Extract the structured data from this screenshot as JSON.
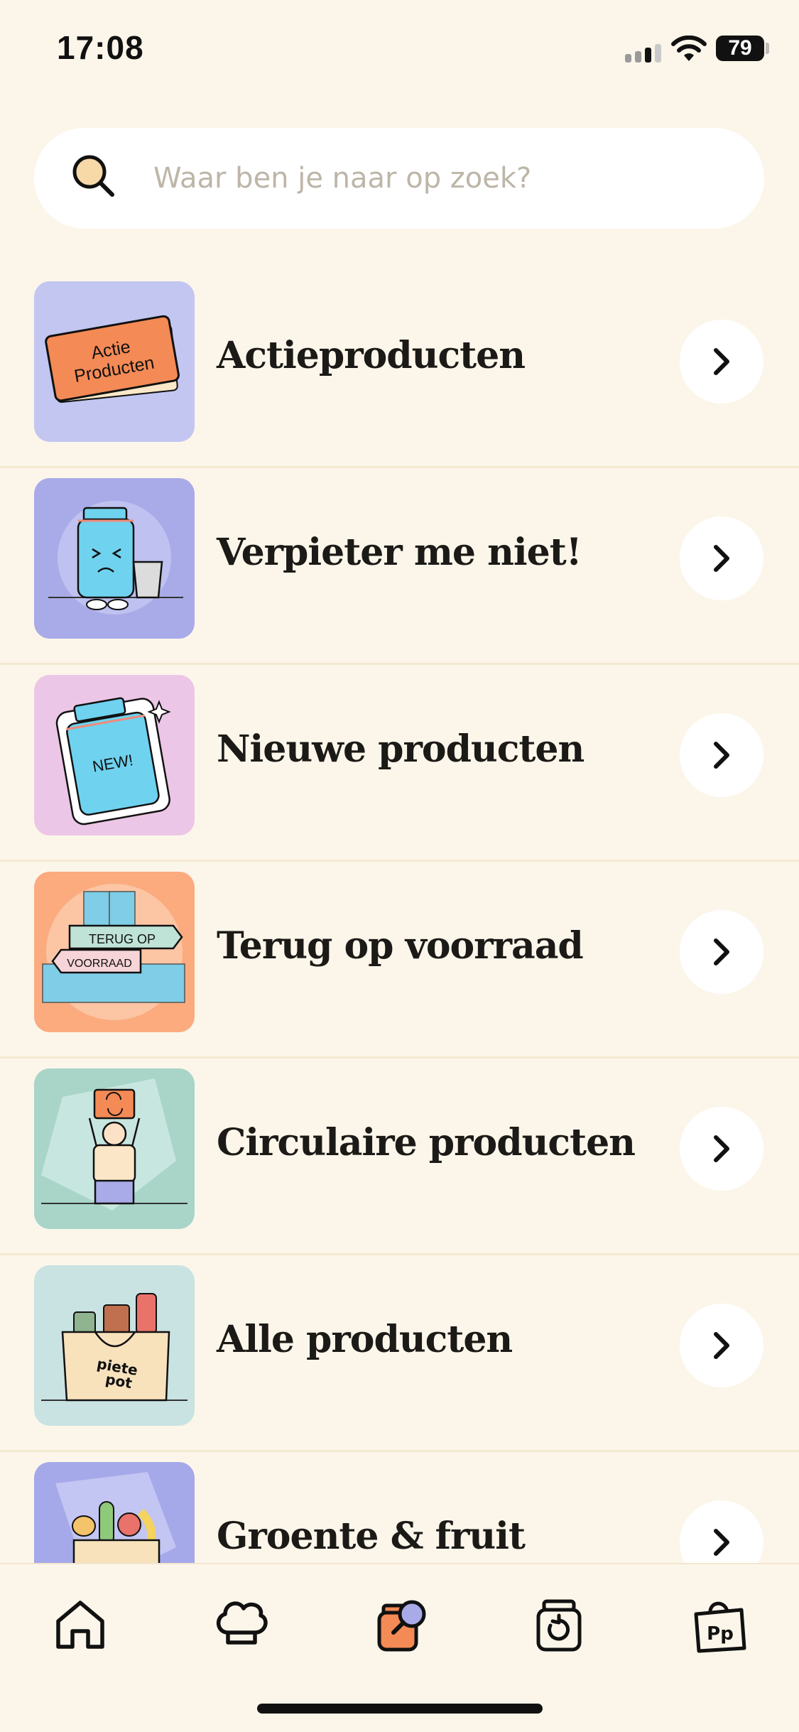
{
  "status_bar": {
    "time": "17:08",
    "battery": "79"
  },
  "search": {
    "placeholder": "Waar ben je naar op zoek?",
    "value": ""
  },
  "categories": [
    {
      "label": "Actieproducten",
      "thumb_text": [
        "Actie",
        "Producten"
      ],
      "thumb_bg": "#c2c6f1"
    },
    {
      "label": "Verpieter me niet!",
      "thumb_bg": "#a9abe8"
    },
    {
      "label": "Nieuwe producten",
      "thumb_text": [
        "NEW!"
      ],
      "thumb_bg": "#ecc6e6"
    },
    {
      "label": "Terug op voorraad",
      "thumb_text": [
        "TERUG OP",
        "VOORRAAD"
      ],
      "thumb_bg": "#fbab7e"
    },
    {
      "label": "Circulaire producten",
      "thumb_bg": "#a8d5c8"
    },
    {
      "label": "Alle producten",
      "thumb_text": [
        "piete",
        "pot"
      ],
      "thumb_bg": "#c9e3e2"
    },
    {
      "label": "Groente & fruit",
      "thumb_bg": "#a5a8e9"
    }
  ],
  "tabs": [
    {
      "name": "home",
      "icon": "home-icon"
    },
    {
      "name": "recipes",
      "icon": "chef-hat-icon"
    },
    {
      "name": "search",
      "icon": "jar-search-icon",
      "active": true
    },
    {
      "name": "reorder",
      "icon": "jar-reorder-icon"
    },
    {
      "name": "shop-bag",
      "icon": "shopping-bag-icon"
    }
  ],
  "colors": {
    "background": "#fcf6ea",
    "text": "#1c1a17",
    "accent_orange": "#f48a55",
    "placeholder": "#bdb6a8"
  }
}
